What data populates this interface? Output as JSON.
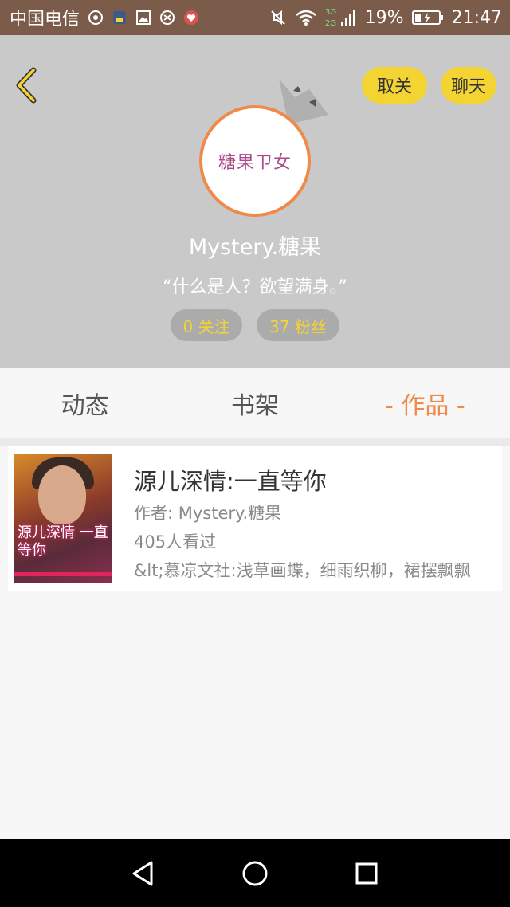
{
  "status_bar": {
    "carrier": "中国电信",
    "network": "3G",
    "network2": "2G",
    "battery": "19%",
    "time": "21:47",
    "icons_left": [
      "chat-bubble-icon",
      "app-icon",
      "image-icon",
      "sync-icon",
      "heart-app-icon"
    ],
    "icons_right": [
      "mute-icon",
      "wifi-icon",
      "signal-icon",
      "battery-charging-icon"
    ]
  },
  "header": {
    "back_icon": "chevron-left-icon",
    "unfollow_label": "取关",
    "chat_label": "聊天",
    "avatar_text": "糖果ㄗ女",
    "username": "Mystery.糖果",
    "motto": "“什么是人？欲望满身。”",
    "following": "0 关注",
    "fans": "37 粉丝"
  },
  "tabs": [
    {
      "label": "动态",
      "active": false
    },
    {
      "label": "书架",
      "active": false
    },
    {
      "label": "- 作品 -",
      "active": true
    }
  ],
  "works": [
    {
      "title": "源儿深情:一直等你",
      "author": "作者: Mystery.糖果",
      "views": "405人看过",
      "description": "&lt;慕凉文社:浅草画蝶，细雨织柳，裙摆飘飘",
      "cover_text": "源儿深情 一直等你"
    }
  ],
  "nav_bar": {
    "back_icon": "triangle-back-icon",
    "home_icon": "circle-home-icon",
    "recents_icon": "square-recents-icon"
  },
  "colors": {
    "accent_yellow": "#f3d433",
    "accent_orange": "#f08a4b",
    "status_bar": "#7b5c4a",
    "header_bg": "#c9c9c9"
  }
}
